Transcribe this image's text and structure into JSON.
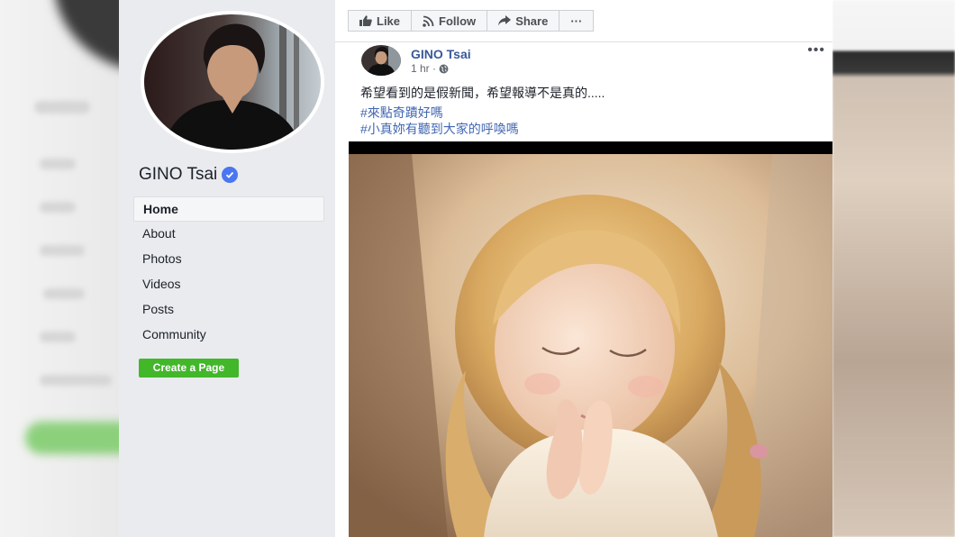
{
  "page": {
    "name": "GINO Tsai",
    "nav": [
      {
        "label": "Home",
        "active": true
      },
      {
        "label": "About",
        "active": false
      },
      {
        "label": "Photos",
        "active": false
      },
      {
        "label": "Videos",
        "active": false
      },
      {
        "label": "Posts",
        "active": false
      },
      {
        "label": "Community",
        "active": false
      }
    ],
    "create_page_label": "Create a Page"
  },
  "action_bar": {
    "like_label": "Like",
    "follow_label": "Follow",
    "share_label": "Share",
    "more_label": "···"
  },
  "post": {
    "author": "GINO Tsai",
    "time": "1 hr ·",
    "more_label": "•••",
    "text": "希望看到的是假新聞，希望報導不是真的.....",
    "hashtags": [
      "#來點奇蹟好嗎",
      "#小真妳有聽到大家的呼喚嗎"
    ]
  },
  "colors": {
    "link_blue": "#385898",
    "hashtag_blue": "#4267b2",
    "create_green": "#42b72a",
    "verified_blue": "#4a76f1",
    "sidebar_bg": "#e9ebee"
  },
  "icons": [
    "thumbs-up-icon",
    "rss-icon",
    "share-arrow-icon",
    "globe-icon",
    "checkmark-icon"
  ]
}
